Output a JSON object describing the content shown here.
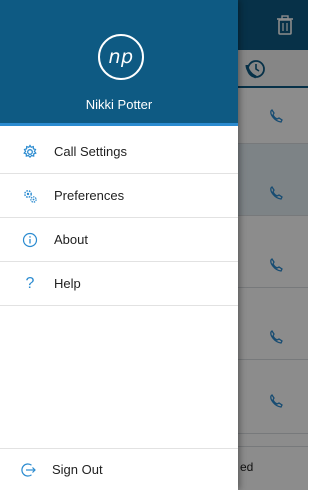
{
  "user": {
    "initials": "np",
    "name": "Nikki Potter"
  },
  "menu": {
    "items": [
      {
        "label": "Call Settings",
        "icon": "gear-icon"
      },
      {
        "label": "Preferences",
        "icon": "gears-icon"
      },
      {
        "label": "About",
        "icon": "info-icon"
      },
      {
        "label": "Help",
        "icon": "help-icon"
      }
    ],
    "sign_out": {
      "label": "Sign Out",
      "icon": "sign-out-icon"
    }
  },
  "background": {
    "bottom_text": "ed"
  },
  "colors": {
    "brand": "#0e5a83",
    "accent": "#2b8bd0"
  }
}
